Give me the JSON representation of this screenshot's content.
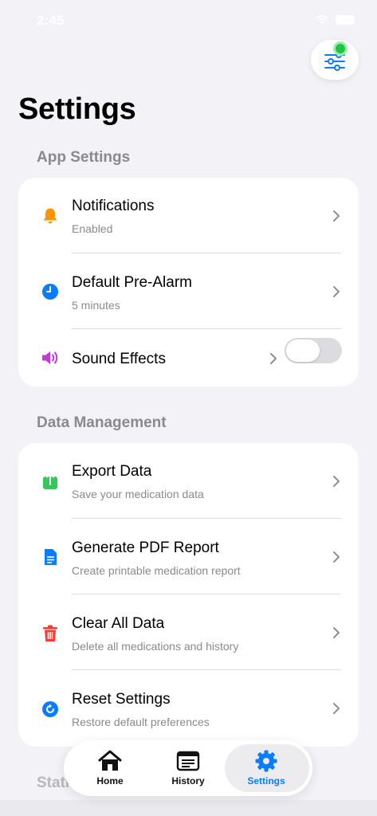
{
  "status_bar": {
    "time": "2:45",
    "wifi_icon": "wifi-icon",
    "battery_icon": "battery-icon"
  },
  "header": {
    "title": "Settings",
    "filter_icon": "sliders-icon"
  },
  "sections": {
    "app_settings": {
      "header": "App Settings",
      "rows": [
        {
          "title": "Notifications",
          "subtitle": "Enabled",
          "icon": "bell-icon",
          "icon_color": "#ff9500"
        },
        {
          "title": "Default Pre-Alarm",
          "subtitle": "5 minutes",
          "icon": "clock-icon",
          "icon_color": "#0a7cff"
        },
        {
          "title": "Sound Effects",
          "icon": "speaker-icon",
          "icon_color": "#c03bd8",
          "toggle_on": false
        }
      ]
    },
    "data_management": {
      "header": "Data Management",
      "rows": [
        {
          "title": "Export Data",
          "subtitle": "Save your medication data",
          "icon": "export-icon",
          "icon_color": "#34c759"
        },
        {
          "title": "Generate PDF Report",
          "subtitle": "Create printable medication report",
          "icon": "document-icon",
          "icon_color": "#0a7cff"
        },
        {
          "title": "Clear All Data",
          "subtitle": "Delete all medications and history",
          "icon": "trash-icon",
          "icon_color": "#ff3b30"
        },
        {
          "title": "Reset Settings",
          "subtitle": "Restore default preferences",
          "icon": "reset-icon",
          "icon_color": "#0a7cff"
        }
      ]
    },
    "statistics_peek": "Stati"
  },
  "tab_bar": {
    "tabs": [
      {
        "label": "Home",
        "icon": "house-icon",
        "active": false
      },
      {
        "label": "History",
        "icon": "newspaper-icon",
        "active": false
      },
      {
        "label": "Settings",
        "icon": "gear-icon",
        "active": true
      }
    ],
    "active_color": "#0a7cff"
  }
}
